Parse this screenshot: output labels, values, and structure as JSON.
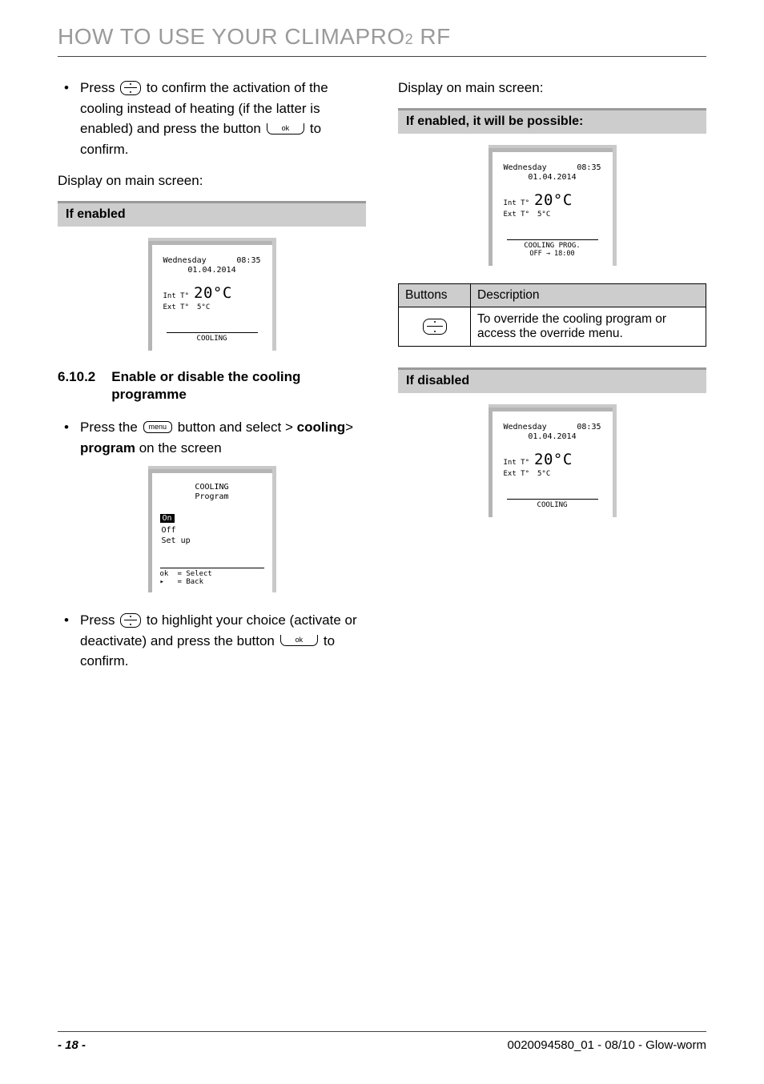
{
  "header": {
    "title_part1": "HOW TO USE YOUR CLIMAPRO",
    "title_sub": "2",
    "title_part2": " RF"
  },
  "left": {
    "bullet1": {
      "pre": "Press ",
      "mid": " to confirm the activation of the cooling instead of heating (if the latter is enabled) and press the button ",
      "post": " to confirm."
    },
    "display_label": "Display on main screen:",
    "band_enabled": "If enabled",
    "lcd1": {
      "day": "Wednesday",
      "time": "08:35",
      "date": "01.04.2014",
      "int_label": "Int T°",
      "int_value": "20°C",
      "ext_label": "Ext T°",
      "ext_value": "5°C",
      "bottom": "COOLING"
    },
    "section_num": "6.10.2",
    "section_title": "Enable or disable the cooling programme",
    "bullet2": {
      "pre": "Press the ",
      "mid": " button and select > ",
      "bold1": "cooling",
      "gt": "> ",
      "bold2": "program",
      "post": " on the screen"
    },
    "lcd2": {
      "title1": "COOLING",
      "title2": "Program",
      "opt_on": "On",
      "opt_off": "Off",
      "opt_setup": "Set up",
      "foot_ok": "ok",
      "foot_ok_v": "= Select",
      "foot_back_k": "▸",
      "foot_back_v": "= Back"
    },
    "bullet3": {
      "pre": "Press ",
      "mid": " to highlight your choice (activate or deactivate) and press the button ",
      "post": " to confirm."
    }
  },
  "right": {
    "display_label": "Display on main screen:",
    "band_enabled_possible": "If enabled, it will be possible:",
    "lcd3": {
      "day": "Wednesday",
      "time": "08:35",
      "date": "01.04.2014",
      "int_label": "Int T°",
      "int_value": "20°C",
      "ext_label": "Ext T°",
      "ext_value": "5°C",
      "bottom1": "COOLING PROG.",
      "bottom2": "OFF → 18:00"
    },
    "table": {
      "h1": "Buttons",
      "h2": "Description",
      "desc": "To override the cooling program or access the override menu."
    },
    "band_disabled": "If disabled",
    "lcd4": {
      "day": "Wednesday",
      "time": "08:35",
      "date": "01.04.2014",
      "int_label": "Int T°",
      "int_value": "20°C",
      "ext_label": "Ext T°",
      "ext_value": "5°C",
      "bottom": "COOLING"
    }
  },
  "buttons": {
    "ok_label": "ok",
    "menu_label": "menu"
  },
  "footer": {
    "page": "- 18 -",
    "docref": "0020094580_01 - 08/10 - Glow-worm"
  }
}
